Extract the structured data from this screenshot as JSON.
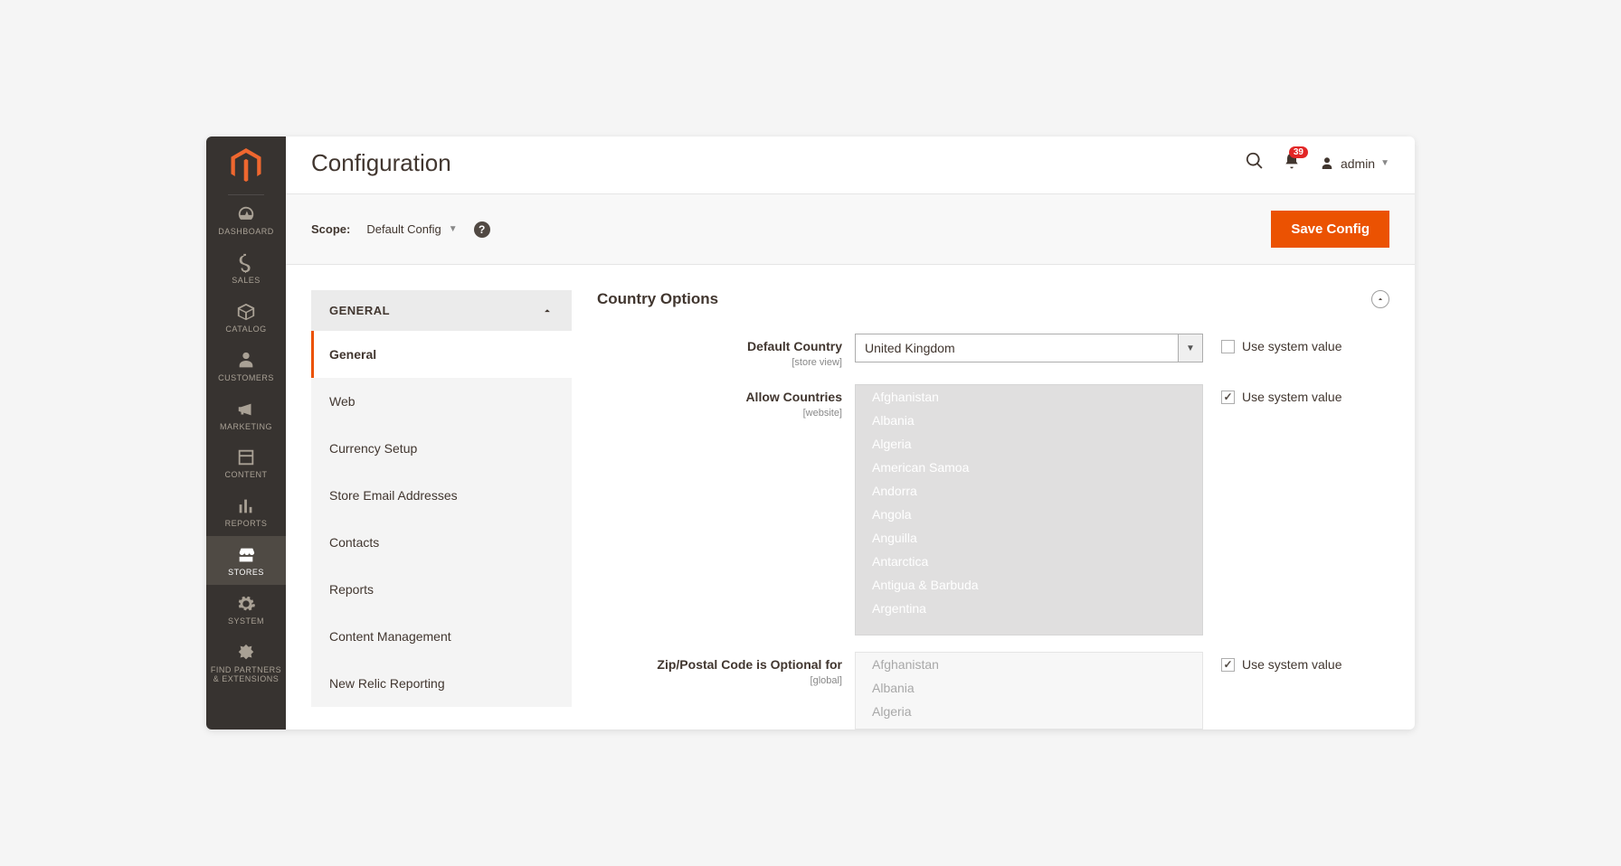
{
  "header": {
    "title": "Configuration",
    "notification_count": "39",
    "user_name": "admin"
  },
  "scope_bar": {
    "label": "Scope:",
    "value": "Default Config",
    "save_button": "Save Config"
  },
  "sidebar": [
    {
      "label": "DASHBOARD"
    },
    {
      "label": "SALES"
    },
    {
      "label": "CATALOG"
    },
    {
      "label": "CUSTOMERS"
    },
    {
      "label": "MARKETING"
    },
    {
      "label": "CONTENT"
    },
    {
      "label": "REPORTS"
    },
    {
      "label": "STORES"
    },
    {
      "label": "SYSTEM"
    },
    {
      "label": "FIND PARTNERS\n& EXTENSIONS"
    }
  ],
  "config_nav": {
    "group": "GENERAL",
    "items": [
      "General",
      "Web",
      "Currency Setup",
      "Store Email Addresses",
      "Contacts",
      "Reports",
      "Content Management",
      "New Relic Reporting"
    ]
  },
  "section": {
    "title": "Country Options"
  },
  "fields": {
    "default_country": {
      "label": "Default Country",
      "scope": "[store view]",
      "value": "United Kingdom",
      "use_system_label": "Use system value",
      "use_system_checked": false
    },
    "allow_countries": {
      "label": "Allow Countries",
      "scope": "[website]",
      "options": [
        "Afghanistan",
        "Albania",
        "Algeria",
        "American Samoa",
        "Andorra",
        "Angola",
        "Anguilla",
        "Antarctica",
        "Antigua & Barbuda",
        "Argentina"
      ],
      "use_system_label": "Use system value",
      "use_system_checked": true
    },
    "zip_optional": {
      "label": "Zip/Postal Code is Optional for",
      "scope": "[global]",
      "options": [
        "Afghanistan",
        "Albania",
        "Algeria"
      ],
      "use_system_label": "Use system value",
      "use_system_checked": true
    }
  }
}
